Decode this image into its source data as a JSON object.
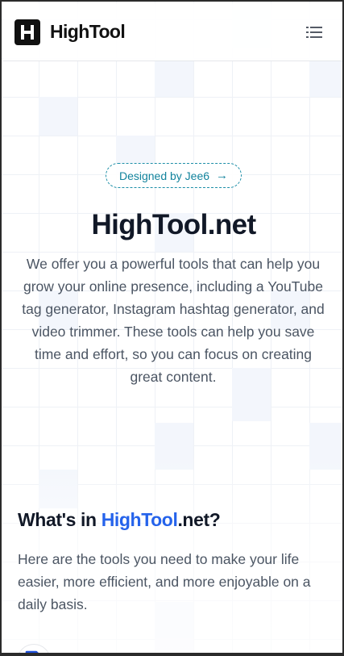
{
  "header": {
    "logo_letter": "H",
    "brand_name": "HighTool",
    "menu_icon": "menu-list-icon"
  },
  "hero": {
    "badge_label": "Designed by Jee6",
    "badge_icon": "arrow-right-icon",
    "title": "HighTool.net",
    "description": "We offer you a powerful tools that can help you grow your online presence, including a YouTube tag generator, Instagram hashtag generator, and video trimmer. These tools can help you save time and effort, so you can focus on creating great content."
  },
  "features": {
    "title_prefix": "What's in ",
    "title_accent": "HighTool",
    "title_suffix": ".net?",
    "description": "Here are the tools you need to make your life easier, more efficient, and more enjoyable on a daily basis.",
    "first_card_icon": "tag-icon"
  },
  "colors": {
    "accent_blue": "#2563eb",
    "badge_teal": "#12839d",
    "text_dark": "#111827",
    "text_muted": "#4b5563"
  }
}
